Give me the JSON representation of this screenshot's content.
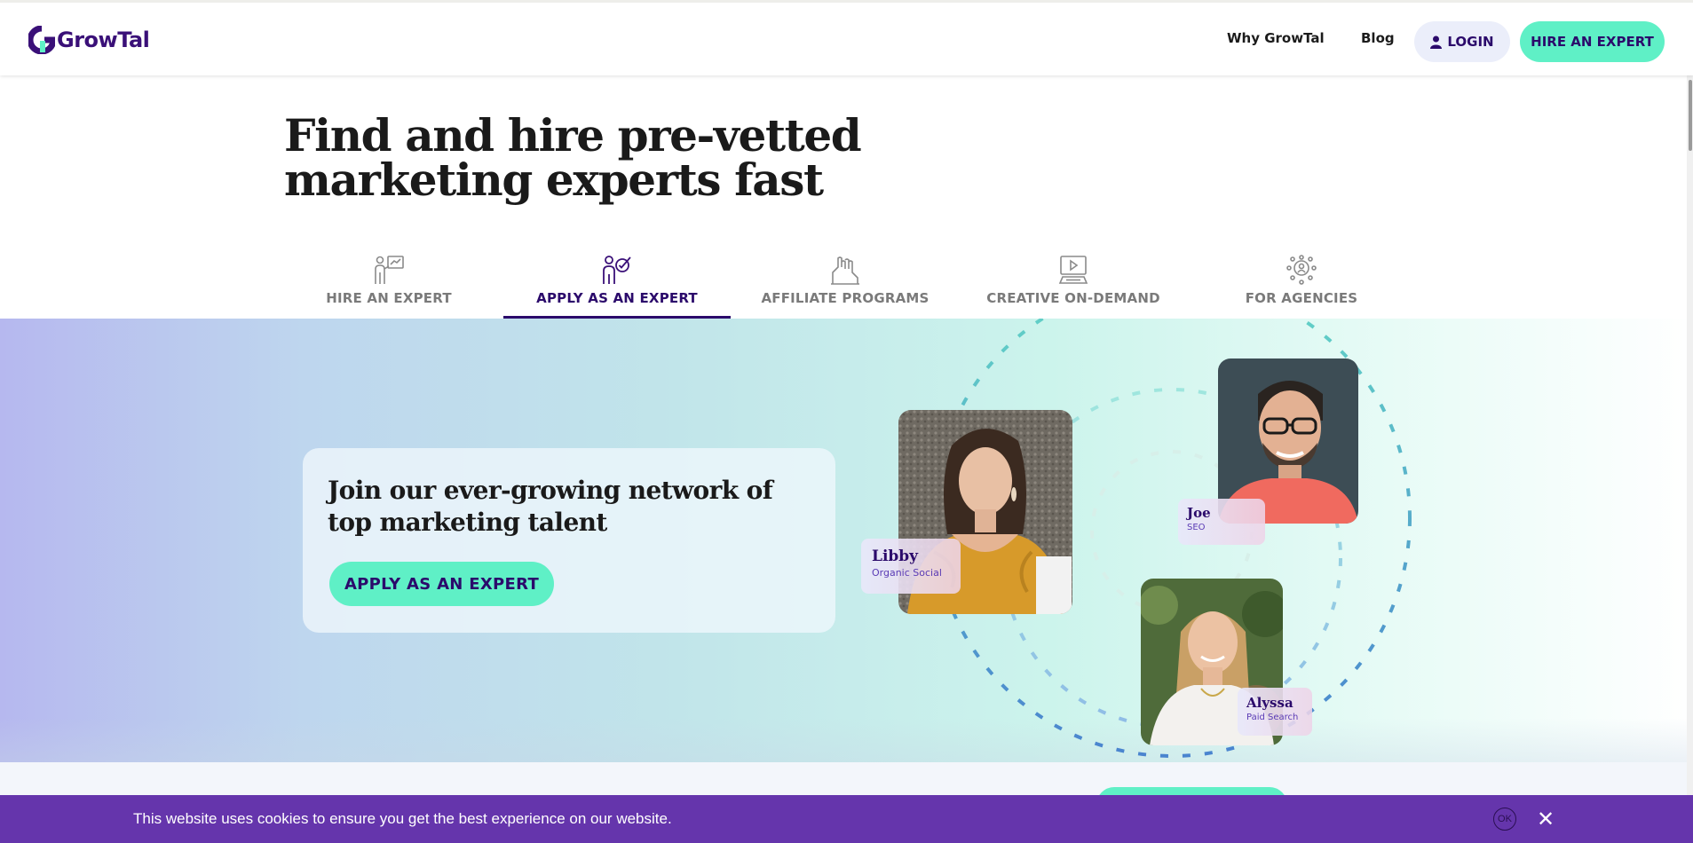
{
  "header": {
    "brand": "GrowTal",
    "nav": [
      {
        "label": "Why GrowTal"
      },
      {
        "label": "Blog"
      }
    ],
    "login_label": "LOGIN",
    "hire_label": "HIRE AN EXPERT"
  },
  "hero": {
    "title_line1": "Find and hire pre-vetted",
    "title_line2": "marketing experts fast"
  },
  "tabs": [
    {
      "label": "HIRE AN EXPERT",
      "icon": "presenter-chart-icon",
      "active": false
    },
    {
      "label": "APPLY AS AN EXPERT",
      "icon": "person-check-icon",
      "active": true
    },
    {
      "label": "AFFILIATE PROGRAMS",
      "icon": "handshake-icon",
      "active": false
    },
    {
      "label": "CREATIVE ON-DEMAND",
      "icon": "video-monitor-icon",
      "active": false
    },
    {
      "label": "FOR AGENCIES",
      "icon": "network-people-icon",
      "active": false
    }
  ],
  "join": {
    "title": "Join our ever-growing network of top marketing talent",
    "cta_label": "APPLY AS AN EXPERT"
  },
  "experts": [
    {
      "name": "Libby",
      "role": "Organic Social"
    },
    {
      "name": "Joe",
      "role": "SEO"
    },
    {
      "name": "Alyssa",
      "role": "Paid Search"
    }
  ],
  "cookie": {
    "message": "This website uses cookies to ensure you get the best experience on our website.",
    "ok_label": "OK",
    "close_label": "✕"
  },
  "colors": {
    "brand_purple": "#2b0a6b",
    "accent_mint": "#5ff0c6",
    "cookie_bar": "#6535ac"
  }
}
